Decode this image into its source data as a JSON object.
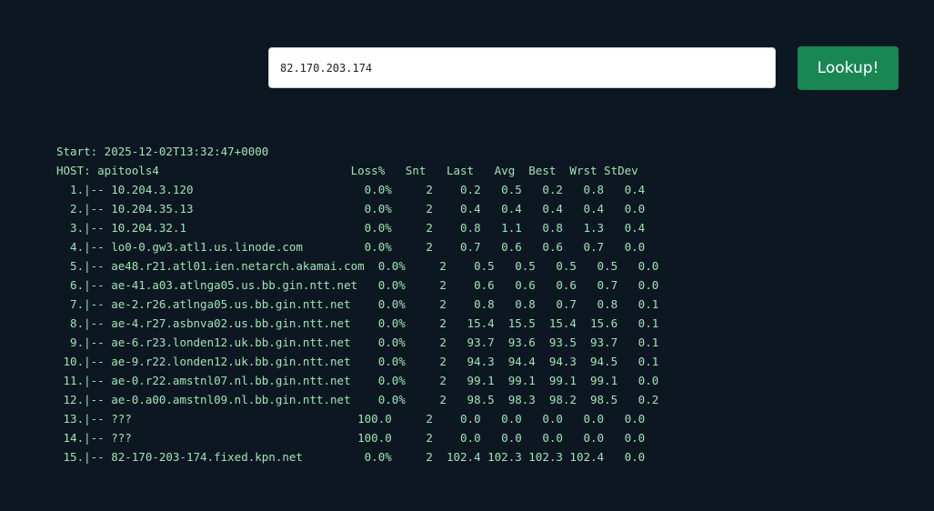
{
  "search": {
    "value": "82.170.203.174"
  },
  "lookup_button": {
    "label": "Lookup!"
  },
  "report": {
    "start_line": "Start: 2025-12-02T13:32:47+0000",
    "header_line": "HOST: apitools4                            Loss%   Snt   Last   Avg  Best  Wrst StDev",
    "hops": [
      "  1.|-- 10.204.3.120                         0.0%     2    0.2   0.5   0.2   0.8   0.4",
      "  2.|-- 10.204.35.13                         0.0%     2    0.4   0.4   0.4   0.4   0.0",
      "  3.|-- 10.204.32.1                          0.0%     2    0.8   1.1   0.8   1.3   0.4",
      "  4.|-- lo0-0.gw3.atl1.us.linode.com         0.0%     2    0.7   0.6   0.6   0.7   0.0",
      "  5.|-- ae48.r21.atl01.ien.netarch.akamai.com  0.0%     2    0.5   0.5   0.5   0.5   0.0",
      "  6.|-- ae-41.a03.atlnga05.us.bb.gin.ntt.net   0.0%     2    0.6   0.6   0.6   0.7   0.0",
      "  7.|-- ae-2.r26.atlnga05.us.bb.gin.ntt.net    0.0%     2    0.8   0.8   0.7   0.8   0.1",
      "  8.|-- ae-4.r27.asbnva02.us.bb.gin.ntt.net    0.0%     2   15.4  15.5  15.4  15.6   0.1",
      "  9.|-- ae-6.r23.londen12.uk.bb.gin.ntt.net    0.0%     2   93.7  93.6  93.5  93.7   0.1",
      " 10.|-- ae-9.r22.londen12.uk.bb.gin.ntt.net    0.0%     2   94.3  94.4  94.3  94.5   0.1",
      " 11.|-- ae-0.r22.amstnl07.nl.bb.gin.ntt.net    0.0%     2   99.1  99.1  99.1  99.1   0.0",
      " 12.|-- ae-0.a00.amstnl09.nl.bb.gin.ntt.net    0.0%     2   98.5  98.3  98.2  98.5   0.2",
      " 13.|-- ???                                 100.0     2    0.0   0.0   0.0   0.0   0.0",
      " 14.|-- ???                                 100.0     2    0.0   0.0   0.0   0.0   0.0",
      " 15.|-- 82-170-203-174.fixed.kpn.net         0.0%     2  102.4 102.3 102.3 102.4   0.0"
    ]
  }
}
